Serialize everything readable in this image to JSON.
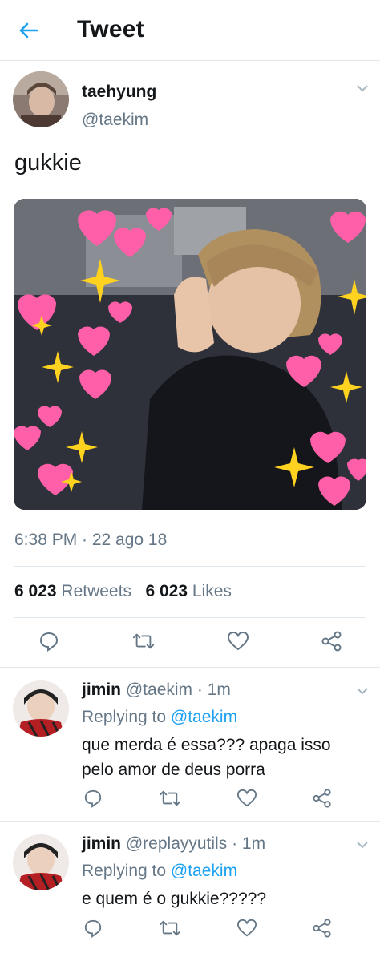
{
  "header": {
    "title": "Tweet",
    "back_icon": "arrow-left-icon"
  },
  "tweet": {
    "name": "taehyung",
    "handle": "@taekim",
    "text": "gukkie",
    "timestamp": "6:38 PM · 22 ago 18",
    "retweets_count": "6 023",
    "retweets_label": "Retweets",
    "likes_count": "6 023",
    "likes_label": "Likes"
  },
  "replies": [
    {
      "name": "jimin",
      "handle": "@taekim",
      "time": "· 1m",
      "replying_to_label": "Replying to",
      "replying_to": "@taekim",
      "text": "que merda é essa??? apaga isso pelo amor de deus porra"
    },
    {
      "name": "jimin",
      "handle": "@replayyutils",
      "time": "· 1m",
      "replying_to_label": "Replying to",
      "replying_to": "@taekim",
      "text": "e quem é o gukkie?????"
    }
  ],
  "colors": {
    "accent": "#1da1f2",
    "secondary_text": "#657786",
    "divider": "#e1e8ed",
    "heart": "#ff5fa8",
    "sparkle": "#ffd21f"
  }
}
